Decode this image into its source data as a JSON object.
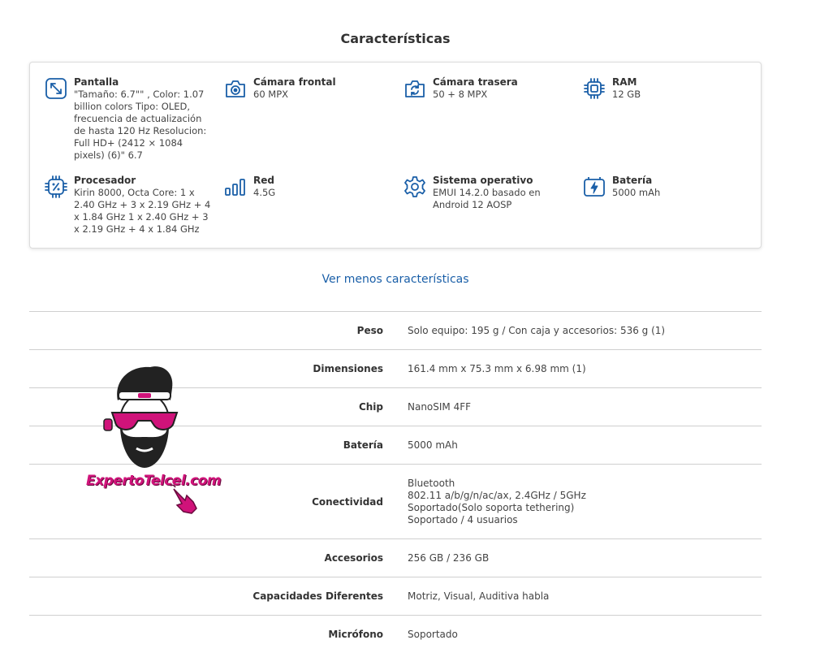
{
  "section": {
    "title": "Características"
  },
  "features": [
    {
      "icon": "screen-expand-icon",
      "label": "Pantalla",
      "value": "\"Tamaño: 6.7\"\" , Color: 1.07 billion colors Tipo: OLED, frecuencia de actualización de hasta 120 Hz Resolucion: Full HD+ (2412 × 1084 pixels) (6)\" 6.7"
    },
    {
      "icon": "front-camera-icon",
      "label": "Cámara frontal",
      "value": "60 MPX"
    },
    {
      "icon": "rear-camera-icon",
      "label": "Cámara trasera",
      "value": "50 + 8 MPX"
    },
    {
      "icon": "ram-chip-icon",
      "label": "RAM",
      "value": "12 GB"
    },
    {
      "icon": "processor-icon",
      "label": "Procesador",
      "value": "Kirin 8000, Octa Core: 1 x 2.40 GHz + 3 x 2.19 GHz + 4 x 1.84 GHz 1 x 2.40 GHz + 3 x 2.19 GHz + 4 x 1.84 GHz"
    },
    {
      "icon": "signal-bars-icon",
      "label": "Red",
      "value": "4.5G"
    },
    {
      "icon": "gear-icon",
      "label": "Sistema operativo",
      "value": "EMUI 14.2.0 basado en Android 12 AOSP"
    },
    {
      "icon": "battery-icon",
      "label": "Batería",
      "value": "5000 mAh"
    }
  ],
  "toggle_link": "Ver menos características",
  "specs": [
    {
      "key": "Peso",
      "values": [
        "Solo equipo: 195 g / Con caja y accesorios: 536 g (1)"
      ]
    },
    {
      "key": "Dimensiones",
      "values": [
        "161.4 mm x 75.3 mm x 6.98 mm (1)"
      ]
    },
    {
      "key": "Chip",
      "values": [
        "NanoSIM 4FF"
      ]
    },
    {
      "key": "Batería",
      "values": [
        "5000 mAh"
      ]
    },
    {
      "key": "Conectividad",
      "values": [
        "Bluetooth",
        "802.11 a/b/g/n/ac/ax, 2.4GHz / 5GHz",
        "Soportado(Solo soporta tethering)",
        "Soportado / 4 usuarios"
      ]
    },
    {
      "key": "Accesorios",
      "values": [
        "256 GB / 236 GB"
      ]
    },
    {
      "key": "Capacidades Diferentes",
      "values": [
        "Motriz, Visual, Auditiva habla"
      ]
    },
    {
      "key": "Micrófono",
      "values": [
        "Soportado"
      ]
    }
  ],
  "watermark": {
    "text": "ExpertoTelcel.com"
  },
  "colors": {
    "icon": "#1a5fa8",
    "link": "#1a5fa8",
    "watermark": "#d0137a"
  }
}
